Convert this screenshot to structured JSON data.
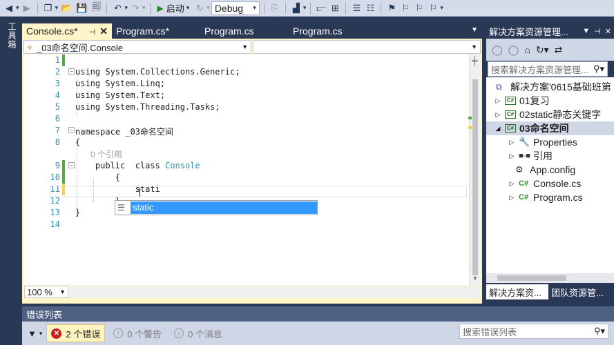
{
  "toolbar": {
    "start_label": "启动",
    "config_value": "Debug"
  },
  "toolbox": {
    "label": "工具箱"
  },
  "tabs": [
    {
      "label": "Console.cs*",
      "active": true
    },
    {
      "label": "Program.cs*",
      "active": false
    },
    {
      "label": "Program.cs",
      "active": false
    },
    {
      "label": "Program.cs",
      "active": false
    }
  ],
  "navbar": {
    "type_value": "_03命名空间.Console",
    "member_value": ""
  },
  "code": {
    "line_numbers": [
      "1",
      "2",
      "3",
      "4",
      "5",
      "6",
      "7",
      "8",
      "9",
      "10",
      "11",
      "12",
      "13",
      "14"
    ],
    "lines": [
      "",
      "using System.Collections.Generic;",
      "using System.Linq;",
      "using System.Text;",
      "using System.Threading.Tasks;",
      "",
      "namespace _03命名空间",
      "{",
      "    public  class ",
      "        {",
      "            stati",
      "        }",
      "}",
      ""
    ],
    "refcount": "0 个引用",
    "class_name": "Console"
  },
  "completion": {
    "item": "static"
  },
  "zoom": {
    "value": "100 %"
  },
  "solution_explorer": {
    "title": "解决方案资源管理...",
    "search_placeholder": "搜索解决方案资源管理...",
    "tree": [
      {
        "label": "解决方案'0615基础班第",
        "level": 0,
        "icon": "solution-icon",
        "expander": ""
      },
      {
        "label": "01复习",
        "level": 1,
        "icon": "csproj-icon",
        "expander": "▷"
      },
      {
        "label": "02static静态关键字",
        "level": 1,
        "icon": "csproj-icon",
        "expander": "▷"
      },
      {
        "label": "03命名空间",
        "level": 1,
        "icon": "csproj-icon",
        "expander": "◢",
        "selected": true,
        "bold": true
      },
      {
        "label": "Properties",
        "level": 2,
        "icon": "wrench-icon",
        "expander": "▷"
      },
      {
        "label": "引用",
        "level": 2,
        "icon": "reference-icon",
        "expander": "▷"
      },
      {
        "label": "App.config",
        "level": 2,
        "icon": "config-icon",
        "expander": ""
      },
      {
        "label": "Console.cs",
        "level": 2,
        "icon": "csfile-icon",
        "expander": "▷"
      },
      {
        "label": "Program.cs",
        "level": 2,
        "icon": "csfile-icon",
        "expander": "▷"
      }
    ],
    "bottom_tabs": [
      "解决方案资...",
      "团队资源管..."
    ]
  },
  "error_list": {
    "title": "错误列表",
    "errors_label": "2 个错误",
    "warnings_label": "0 个警告",
    "messages_label": "0 个消息",
    "search_placeholder": "搜索错误列表"
  }
}
